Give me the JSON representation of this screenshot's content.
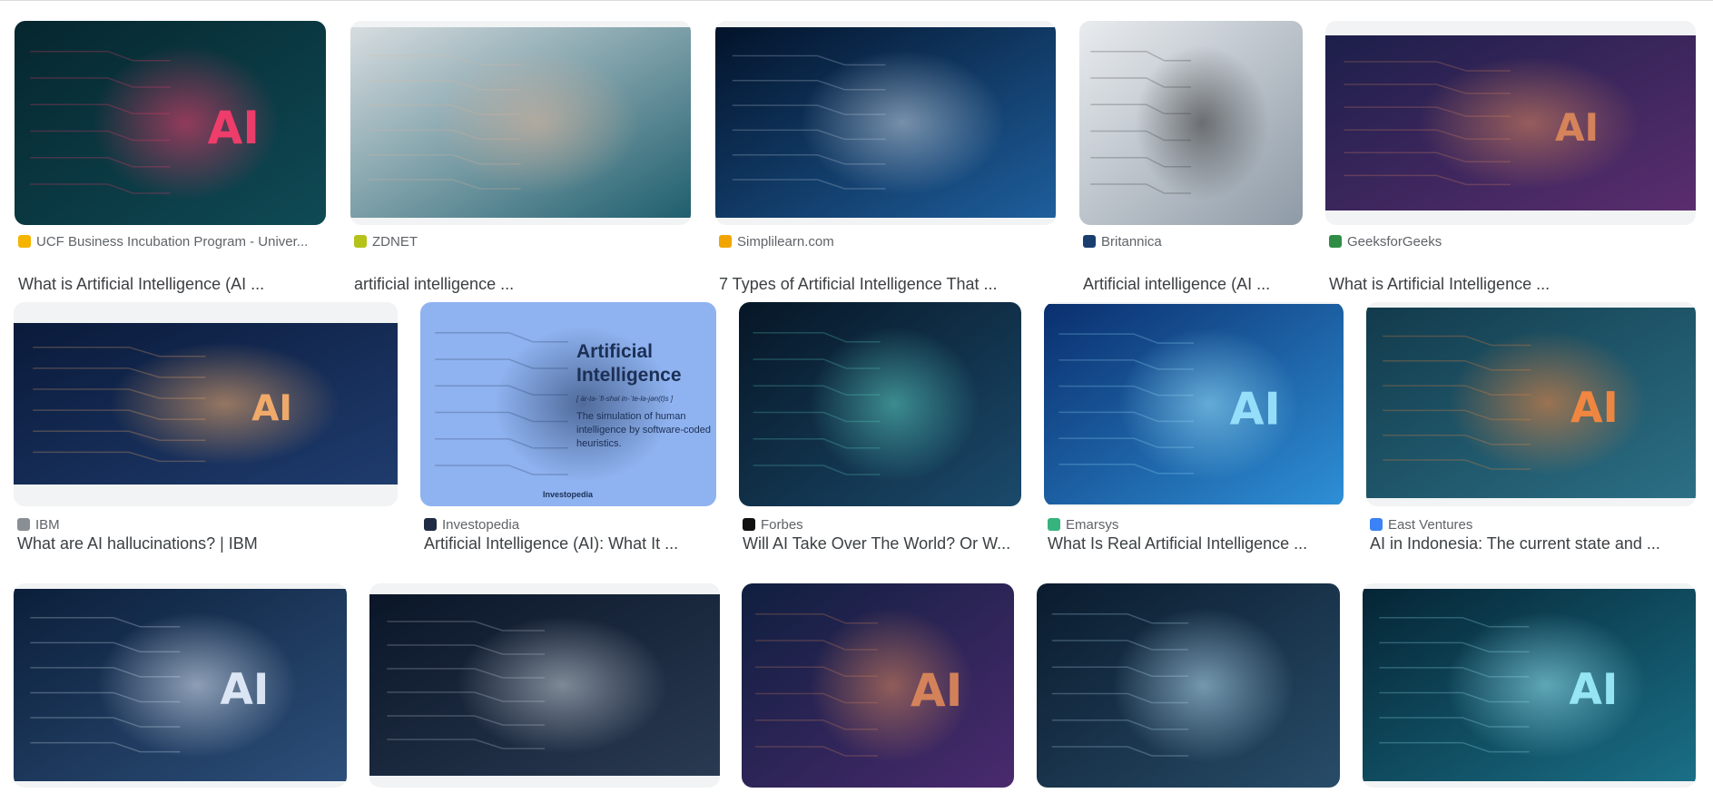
{
  "results": [
    {
      "source": "UCF Business Incubation Program - Univer...",
      "title": "What is Artificial Intelligence (AI ...",
      "favicon": "ucf-favicon",
      "fav_color": "#f4b400",
      "thumb": {
        "bg1": "#06262e",
        "bg2": "#0f4a55",
        "accent": "#ff3d6e",
        "text": "AI"
      }
    },
    {
      "source": "ZDNET",
      "title": "artificial intelligence ...",
      "favicon": "zdnet-favicon",
      "fav_color": "#b5c21a",
      "thumb": {
        "bg1": "#d7dde0",
        "bg2": "#1f5f6e",
        "accent": "#e0b59c",
        "text": ""
      }
    },
    {
      "source": "Simplilearn.com",
      "title": "7 Types of Artificial Intelligence That ...",
      "favicon": "simplilearn-favicon",
      "fav_color": "#f0a500",
      "thumb": {
        "bg1": "#03132a",
        "bg2": "#1e5e9c",
        "accent": "#c9d5e2",
        "text": ""
      }
    },
    {
      "source": "Britannica",
      "title": "Artificial intelligence (AI ...",
      "favicon": "britannica-favicon",
      "fav_color": "#1a3e6e",
      "thumb": {
        "bg1": "#e9ecef",
        "bg2": "#8e9aa6",
        "accent": "#2b2b2b",
        "text": ""
      }
    },
    {
      "source": "GeeksforGeeks",
      "title": "What is Artificial Intelligence ...",
      "favicon": "geeksforgeeks-favicon",
      "fav_color": "#2f8d46",
      "thumb": {
        "bg1": "#1c1f4a",
        "bg2": "#5a2d6e",
        "accent": "#e08a5a",
        "text": "AI"
      }
    },
    {
      "source": "IBM",
      "title": "What are AI hallucinations? | IBM",
      "favicon": "ibm-favicon",
      "fav_color": "#8a8f95",
      "thumb": {
        "bg1": "#0a1a3a",
        "bg2": "#1f3c6e",
        "accent": "#ffb36b",
        "text": "AI"
      }
    },
    {
      "source": "Investopedia",
      "title": "Artificial Intelligence (AI): What It ...",
      "favicon": "investopedia-favicon",
      "fav_color": "#1f2a44",
      "thumb": {
        "bg1": "#8fb3f0",
        "bg2": "#8fb3f0",
        "accent": "#1c2f55",
        "text": ""
      },
      "card_text": {
        "heading": "Artificial Intelligence",
        "pron": "[ är-tə-ˈfi-shəl in-ˈte-lə-jən(t)s ]",
        "body": "The simulation of human intelligence by software-coded heuristics.",
        "brand": "Investopedia"
      }
    },
    {
      "source": "Forbes",
      "title": "Will AI Take Over The World? Or W...",
      "favicon": "forbes-favicon",
      "fav_color": "#111111",
      "thumb": {
        "bg1": "#061626",
        "bg2": "#1b4a6b",
        "accent": "#5fd6c8",
        "text": ""
      }
    },
    {
      "source": "Emarsys",
      "title": "What Is Real Artificial Intelligence ...",
      "favicon": "emarsys-favicon",
      "fav_color": "#36b37e",
      "thumb": {
        "bg1": "#0a2f6e",
        "bg2": "#2e8fd6",
        "accent": "#9ee7ff",
        "text": "AI"
      }
    },
    {
      "source": "East Ventures",
      "title": "AI in Indonesia: The current state and ...",
      "favicon": "eastventures-favicon",
      "fav_color": "#3b82f6",
      "thumb": {
        "bg1": "#123b4c",
        "bg2": "#2c6f85",
        "accent": "#ff8a3d",
        "text": "AI"
      }
    },
    {
      "source": "",
      "title": "",
      "favicon": "",
      "fav_color": "",
      "thumb": {
        "bg1": "#0b1f3a",
        "bg2": "#2d4f7a",
        "accent": "#e9f2ff",
        "text": "AI"
      }
    },
    {
      "source": "",
      "title": "",
      "favicon": "",
      "fav_color": "",
      "thumb": {
        "bg1": "#0a1628",
        "bg2": "#2a3a52",
        "accent": "#cfd6de",
        "text": ""
      }
    },
    {
      "source": "",
      "title": "",
      "favicon": "",
      "fav_color": "",
      "thumb": {
        "bg1": "#0f1f3f",
        "bg2": "#4a2a6e",
        "accent": "#e08a5a",
        "text": "AI"
      }
    },
    {
      "source": "",
      "title": "",
      "favicon": "",
      "fav_color": "",
      "thumb": {
        "bg1": "#0a1b2e",
        "bg2": "#284c68",
        "accent": "#bfe8ff",
        "text": ""
      }
    },
    {
      "source": "",
      "title": "",
      "favicon": "",
      "fav_color": "",
      "thumb": {
        "bg1": "#052535",
        "bg2": "#1a6f86",
        "accent": "#9ff0ff",
        "text": "AI"
      }
    }
  ]
}
